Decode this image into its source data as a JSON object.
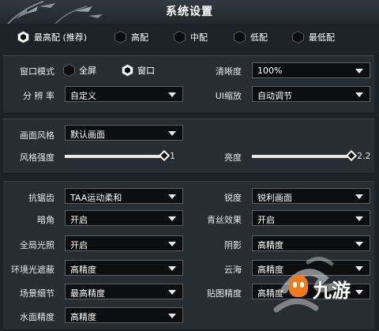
{
  "title": "系统设置",
  "presets": [
    {
      "label": "最高配 (推荐)",
      "selected": true
    },
    {
      "label": "高配",
      "selected": false
    },
    {
      "label": "中配",
      "selected": false
    },
    {
      "label": "低配",
      "selected": false
    },
    {
      "label": "最低配",
      "selected": false
    }
  ],
  "display": {
    "window_mode_label": "窗口模式",
    "fullscreen_label": "全屏",
    "windowed_label": "窗口",
    "window_mode_selected": "windowed",
    "resolution_label": "分 辨 率",
    "resolution_value": "自定义",
    "clarity_label": "清晰度",
    "clarity_value": "100%",
    "ui_scale_label": "UI缩放",
    "ui_scale_value": "自动调节"
  },
  "style": {
    "style_label": "画面风格",
    "style_value": "默认画面",
    "strength_label": "风格强度",
    "strength_value": "1",
    "strength_level": 1.0,
    "brightness_label": "亮度",
    "brightness_value": "2.2",
    "brightness_level": 1.0
  },
  "quality": {
    "aa_label": "抗锯齿",
    "aa_value": "TAA运动柔和",
    "sharpness_label": "锐度",
    "sharpness_value": "锐利画面",
    "vignette_label": "暗角",
    "vignette_value": "开启",
    "hair_label": "青丝效果",
    "hair_value": "开启",
    "gi_label": "全局光照",
    "gi_value": "开启",
    "shadow_label": "阴影",
    "shadow_value": "高精度",
    "ao_label": "环境光遮蔽",
    "ao_value": "高精度",
    "cloud_label": "云海",
    "cloud_value": "高精度",
    "scene_label": "场景细节",
    "scene_value": "最高精度",
    "texture_label": "贴图精度",
    "texture_value": "高精度",
    "water_label": "水面精度",
    "water_value": "高精度"
  },
  "watermark": {
    "text": "九游",
    "color": "#f07a1e"
  }
}
